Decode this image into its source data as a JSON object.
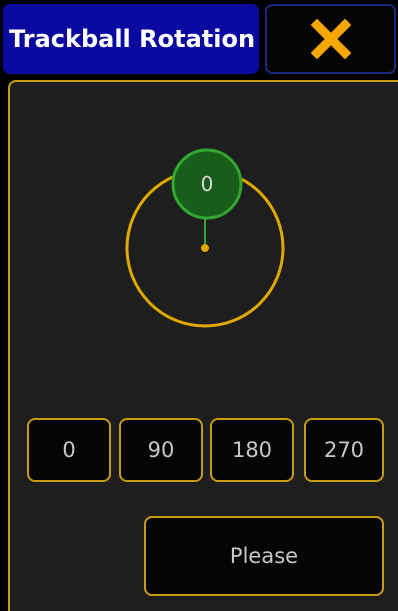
{
  "window": {
    "title": "Trackball Rotation",
    "close_icon": "close-x-icon"
  },
  "trackball": {
    "handle_value": "0",
    "rotation_degrees": 0
  },
  "presets": [
    "0",
    "90",
    "180",
    "270"
  ],
  "actions": {
    "please_label": "Please"
  },
  "colors": {
    "title_bg": "#0a0aa0",
    "accent_gold": "#e0a800",
    "handle_green": "#1a5c1a",
    "handle_border": "#2fa82f",
    "panel_bg": "#1e1e1e"
  }
}
